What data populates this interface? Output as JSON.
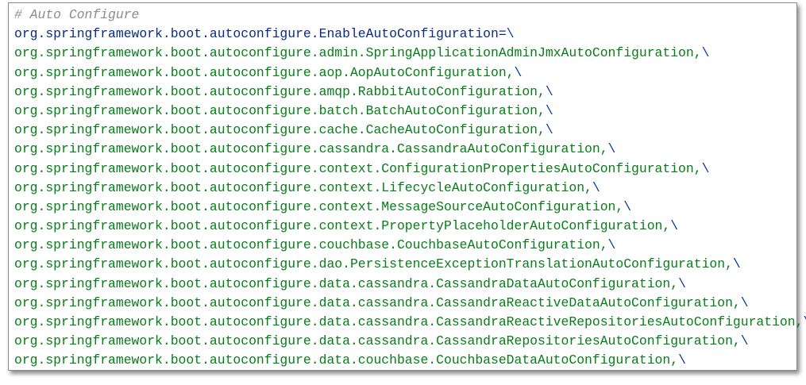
{
  "comment": "# Auto Configure",
  "key_line": {
    "key": "org.springframework.boot.autoconfigure.EnableAutoConfiguration",
    "sep": "=",
    "cont": "\\"
  },
  "values": [
    "org.springframework.boot.autoconfigure.admin.SpringApplicationAdminJmxAutoConfiguration,",
    "org.springframework.boot.autoconfigure.aop.AopAutoConfiguration,",
    "org.springframework.boot.autoconfigure.amqp.RabbitAutoConfiguration,",
    "org.springframework.boot.autoconfigure.batch.BatchAutoConfiguration,",
    "org.springframework.boot.autoconfigure.cache.CacheAutoConfiguration,",
    "org.springframework.boot.autoconfigure.cassandra.CassandraAutoConfiguration,",
    "org.springframework.boot.autoconfigure.context.ConfigurationPropertiesAutoConfiguration,",
    "org.springframework.boot.autoconfigure.context.LifecycleAutoConfiguration,",
    "org.springframework.boot.autoconfigure.context.MessageSourceAutoConfiguration,",
    "org.springframework.boot.autoconfigure.context.PropertyPlaceholderAutoConfiguration,",
    "org.springframework.boot.autoconfigure.couchbase.CouchbaseAutoConfiguration,",
    "org.springframework.boot.autoconfigure.dao.PersistenceExceptionTranslationAutoConfiguration,",
    "org.springframework.boot.autoconfigure.data.cassandra.CassandraDataAutoConfiguration,",
    "org.springframework.boot.autoconfigure.data.cassandra.CassandraReactiveDataAutoConfiguration,",
    "org.springframework.boot.autoconfigure.data.cassandra.CassandraReactiveRepositoriesAutoConfiguration,",
    "org.springframework.boot.autoconfigure.data.cassandra.CassandraRepositoriesAutoConfiguration,",
    "org.springframework.boot.autoconfigure.data.couchbase.CouchbaseDataAutoConfiguration,"
  ],
  "continuation": "\\",
  "colors": {
    "comment": "#8c8c8c",
    "key": "#0b2b80",
    "value": "#067d17",
    "backslash": "#0037a6"
  }
}
